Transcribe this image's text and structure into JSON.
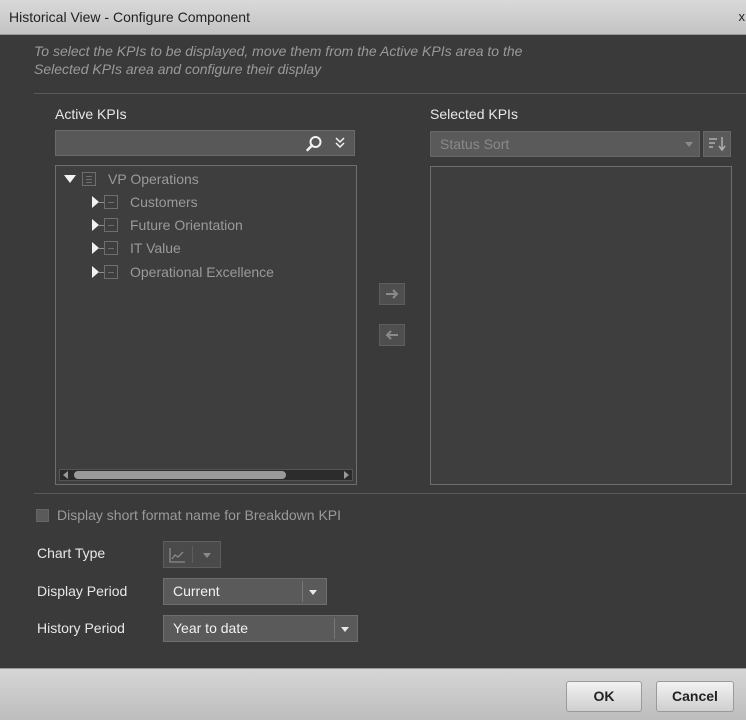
{
  "window": {
    "title": "Historical View - Configure Component",
    "close_glyph": "x"
  },
  "instructions": {
    "line1": "To select the KPIs to be displayed, move them from the Active KPIs area to the",
    "line2": "Selected KPIs area and configure their display"
  },
  "active_kpis": {
    "label": "Active KPIs",
    "search_value": "",
    "tree": {
      "root": {
        "label": "VP Operations",
        "expanded": true
      },
      "children": [
        {
          "label": "Customers"
        },
        {
          "label": "Future Orientation"
        },
        {
          "label": "IT Value"
        },
        {
          "label": "Operational Excellence"
        }
      ]
    }
  },
  "move_buttons": {
    "add_icon": "arrow-right-icon",
    "remove_icon": "arrow-left-icon"
  },
  "selected_kpis": {
    "label": "Selected KPIs",
    "sort_value": "Status Sort",
    "items": []
  },
  "options": {
    "short_format_label": "Display short format name for Breakdown KPI",
    "short_format_checked": false,
    "chart_type_label": "Chart Type",
    "chart_type_icon": "line-chart-icon",
    "display_period_label": "Display Period",
    "display_period_value": "Current",
    "history_period_label": "History Period",
    "history_period_value": "Year to date"
  },
  "footer": {
    "ok_label": "OK",
    "cancel_label": "Cancel"
  },
  "colors": {
    "background": "#3a3a3a",
    "titlebar": "#c8c8c8",
    "panel": "#3e3e3e",
    "muted_text": "#9a9a9a"
  }
}
